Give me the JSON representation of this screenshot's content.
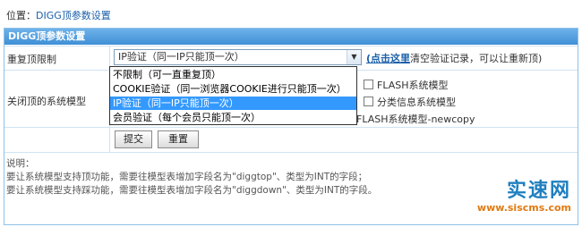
{
  "breadcrumb": {
    "prefix": "位置：",
    "current": "DIGG顶参数设置"
  },
  "panel": {
    "title": "DIGG顶参数设置"
  },
  "repeat_limit": {
    "label": "重复顶限制",
    "selected": "IP验证（同一IP只能顶一次）",
    "hint_link": "(点击这里",
    "hint_rest": "清空验证记录，可以让重新顶)",
    "options": [
      "不限制（可一直重复顶）",
      "COOKIE验证（同一浏览器COOKIE进行只能顶一次）",
      "IP验证（同一IP只能顶一次）",
      "会员验证（每个会员只能顶一次）"
    ],
    "selected_index": 2
  },
  "models": {
    "label": "关闭顶的系统模型",
    "checkboxes": [
      "FLASH系统模型",
      "分类信息系统模型"
    ],
    "extra_text": "FLASH系统模型-newcopy"
  },
  "buttons": {
    "submit": "提交",
    "reset": "重置"
  },
  "notes": {
    "heading": "说明：",
    "line1": "要让系统模型支持顶功能，需要往模型表增加字段名为\"diggtop\"、类型为INT的字段；",
    "line2": "要让系统模型支持踩功能，需要往模型表增加字段名为\"diggdown\"、类型为INT的字段。"
  },
  "watermark": {
    "title": "实速网",
    "url": "www.siscms.com"
  }
}
